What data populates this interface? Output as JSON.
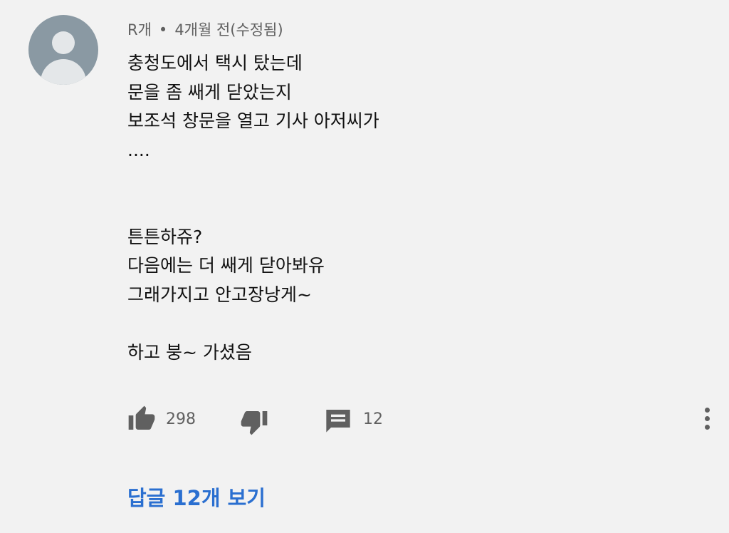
{
  "comment": {
    "author": "R개",
    "separator": "•",
    "timestamp": "4개월 전(수정됨)",
    "lines": [
      "충청도에서 택시 탔는데",
      "문을 좀 쌔게 닫았는지",
      "보조석 창문을 열고 기사 아저씨가",
      "....",
      "",
      "",
      "튼튼하쥬?",
      "다음에는 더 쌔게 닫아봐유",
      "그래가지고 안고장낭게~",
      "",
      "하고 붕~ 가셨음"
    ]
  },
  "actions": {
    "like_count": "298",
    "reply_count": "12",
    "like_icon": "thumbs-up-icon",
    "dislike_icon": "thumbs-down-icon",
    "reply_icon": "comment-icon",
    "more_icon": "more-vertical-icon"
  },
  "replies": {
    "label": "답글 12개 보기",
    "color": "#2a6fd0"
  }
}
